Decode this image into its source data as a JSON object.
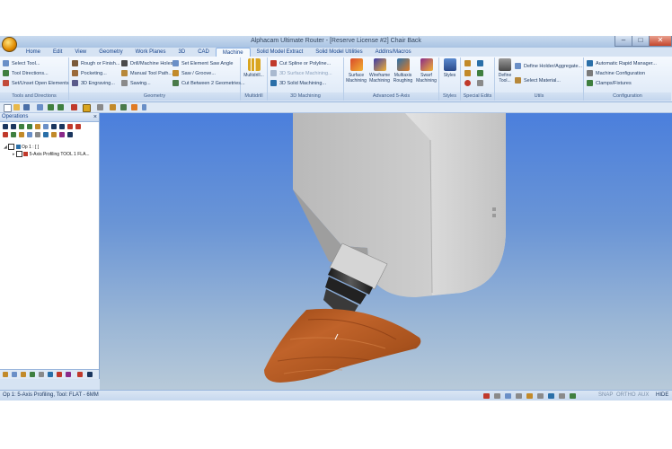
{
  "window": {
    "title": "Alphacam Ultimate Router - [Reserve License #2] Chair Back",
    "min_glyph": "–",
    "max_glyph": "□",
    "close_glyph": "✕"
  },
  "tabs": [
    "Home",
    "Edit",
    "View",
    "Geometry",
    "Work Planes",
    "3D",
    "CAD",
    "Machine",
    "Solid Model Extract",
    "Solid Model Utilities",
    "AddIns/Macros"
  ],
  "ribbon": {
    "tools_directions": {
      "label": "Tools and Directions",
      "items": [
        "Select Tool...",
        "Tool Directions...",
        "Set/Unset Open Elements"
      ]
    },
    "geometry": {
      "label": "Geometry",
      "col1": [
        "Rough or Finish...",
        "Pocketing...",
        "3D Engraving..."
      ],
      "col2": [
        "Drill/Machine Holes...",
        "Manual Tool Path...",
        "Sawing..."
      ],
      "col3": [
        "Set Element Saw Angle",
        "Saw / Groove...",
        "Cut Between 2 Geometries..."
      ]
    },
    "multidrill": {
      "label": "Multidrill",
      "button": "Multidrill..."
    },
    "machining_3d": {
      "label": "3D Machining",
      "items": [
        "Cut Spline or Polyline...",
        "3D Surface Machining...",
        "3D Solid Machining..."
      ]
    },
    "advanced_5axis": {
      "label": "Advanced 5-Axis",
      "buttons": [
        "Surface Machining",
        "Wireframe Machining",
        "Multiaxis Roughing",
        "Swarf Machining"
      ]
    },
    "styles": {
      "label": "Styles",
      "button": "Styles"
    },
    "special_edits": {
      "label": "Special Edits"
    },
    "utils": {
      "label": "Utils",
      "buttons": [
        "Define Tool..."
      ],
      "items": [
        "Define Holder/Aggregate...",
        "Select Material..."
      ]
    },
    "configuration": {
      "label": "Configuration",
      "items": [
        "Automatic Rapid Manager...",
        "Machine Configuration",
        "Clamps/Fixtures"
      ]
    }
  },
  "operations_panel": {
    "title": "Operations",
    "close_glyph": "×",
    "tree": [
      {
        "text": "Op 1 : [ ]"
      },
      {
        "text": "5-Axis Profiling  TOOL 1   FLA..."
      }
    ]
  },
  "status": {
    "text": "Op 1: 5-Axis Profiling, Tool: FLAT - 6MM",
    "snap": "SNAP",
    "ortho": "ORTHO",
    "aux": "AUX",
    "hide": "HIDE"
  },
  "colors": {
    "viewport_top": "#4b7fdc",
    "viewport_bottom": "#b8cad9",
    "part_wood": "#b4541a",
    "machine_head": "#c9c9c9",
    "ribbon_text": "#15428b"
  },
  "icons": [
    "app-orb-icon",
    "save-icon",
    "open-icon",
    "undo-icon",
    "redo-icon",
    "close-icon"
  ]
}
